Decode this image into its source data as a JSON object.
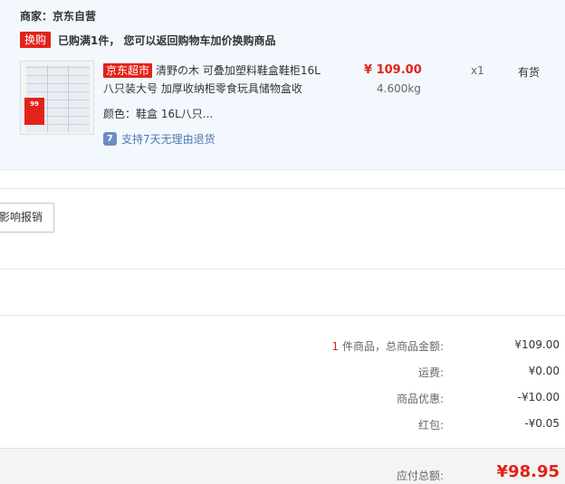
{
  "shop": {
    "seller_label": "商家：京东自营",
    "promo_badge": "换购",
    "promo_text": "已购满1件， 您可以返回购物车加价换购商品"
  },
  "product": {
    "store_tag": "京东超市",
    "title": "清野の木 可叠加塑料鞋盒鞋柜16L八只装大号 加厚收纳柜零食玩具储物盒收",
    "thumb_sale_text": "99",
    "price": "¥ 109.00",
    "weight": "4.600kg",
    "quantity": "x1",
    "stock": "有货",
    "color_label": "颜色：鞋盒 16L八只...",
    "return_icon_text": "7",
    "return_text": "支持7天无理由退货"
  },
  "invoice": {
    "impact_button": "影响报销"
  },
  "summary": {
    "items_count": "1",
    "items_label": " 件商品，总商品金额:",
    "items_amount": "¥109.00",
    "shipping_label": "运费:",
    "shipping_amount": "¥0.00",
    "discount_label": "商品优惠:",
    "discount_amount": "-¥10.00",
    "redpacket_label": "红包:",
    "redpacket_amount": "-¥0.05",
    "total_label": "应付总额:",
    "total_amount": "¥98.95"
  },
  "colors": {
    "accent_red": "#e2231a",
    "panel_bg": "#f3f8fe",
    "link_blue": "#5078b3"
  }
}
